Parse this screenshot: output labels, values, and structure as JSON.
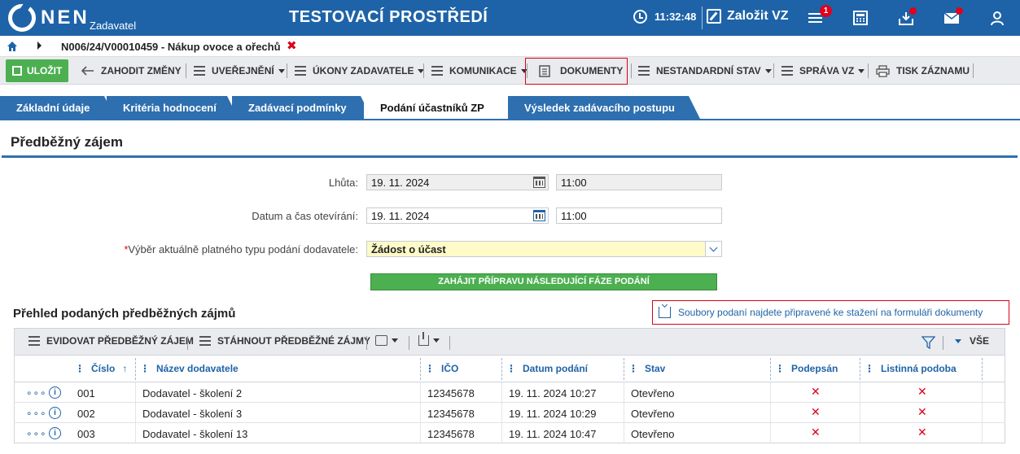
{
  "header": {
    "logo_text": "NEN",
    "logo_sub": "Zadavatel",
    "env_title": "TESTOVACÍ PROSTŘEDÍ",
    "time": "11:32:48",
    "create_label": "Založit VZ",
    "notifications_count": "1"
  },
  "breadcrumb": {
    "record": "N006/24/V00010459 - Nákup ovoce a ořechů"
  },
  "toolbar": {
    "save": "ULOŽIT",
    "discard": "ZAHODIT ZMĚNY",
    "publish": "UVEŘEJNĚNÍ",
    "actions": "ÚKONY ZADAVATELE",
    "communication": "KOMUNIKACE",
    "documents": "DOKUMENTY",
    "nonstandard": "NESTANDARDNÍ STAV",
    "management": "SPRÁVA VZ",
    "print": "TISK ZÁZNAMU"
  },
  "tabs": [
    {
      "label": "Základní údaje"
    },
    {
      "label": "Kritéria hodnocení"
    },
    {
      "label": "Zadávací podmínky"
    },
    {
      "label": "Podání účastníků ZP"
    },
    {
      "label": "Výsledek zadávacího postupu"
    }
  ],
  "section": {
    "title": "Předběžný zájem",
    "deadline_label": "Lhůta:",
    "deadline_date": "19. 11. 2024",
    "deadline_time": "11:00",
    "open_label": "Datum a čas otevírání:",
    "open_date": "19. 11. 2024",
    "open_time": "11:00",
    "type_label": "Výběr aktuálně platného typu podání dodavatele:",
    "type_required": "*",
    "type_value": "Žádost o účast",
    "next_phase_button": "ZAHÁJIT PŘÍPRAVU NÁSLEDUJÍCÍ FÁZE PODÁNÍ"
  },
  "overview": {
    "title": "Přehled podaných předběžných zájmů",
    "docs_link": "Soubory podaní najdete připravené ke stažení na formuláři dokumenty",
    "btn_register": "EVIDOVAT PŘEDBĚŽNÝ ZÁJEM",
    "btn_download": "STÁHNOUT PŘEDBĚŽNÉ ZÁJMY",
    "view_all": "VŠE",
    "columns": {
      "number": "Číslo",
      "supplier": "Název dodavatele",
      "ico": "IČO",
      "date": "Datum podání",
      "state": "Stav",
      "signed": "Podepsán",
      "paper": "Listinná podoba"
    },
    "rows": [
      {
        "number": "001",
        "supplier": "Dodavatel - školení 2",
        "ico": "12345678",
        "date": "19. 11. 2024 10:27",
        "state": "Otevřeno"
      },
      {
        "number": "002",
        "supplier": "Dodavatel - školení 3",
        "ico": "12345678",
        "date": "19. 11. 2024 10:29",
        "state": "Otevřeno"
      },
      {
        "number": "003",
        "supplier": "Dodavatel - školení 13",
        "ico": "12345678",
        "date": "19. 11. 2024 10:47",
        "state": "Otevřeno"
      }
    ]
  }
}
